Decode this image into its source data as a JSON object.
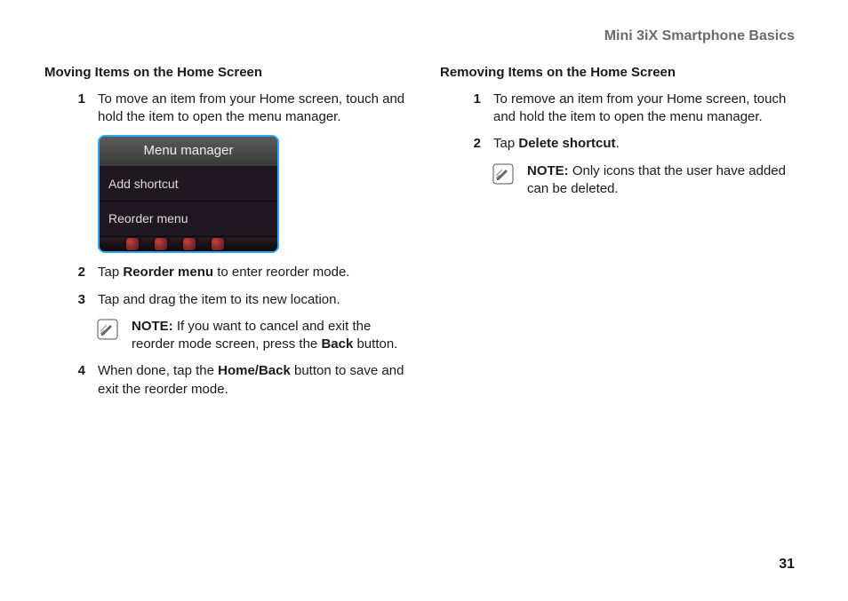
{
  "header": "Mini 3iX Smartphone Basics",
  "page_number": "31",
  "left": {
    "title": "Moving Items on the Home Screen",
    "step1_num": "1",
    "step1_text": "To move an item from your Home screen, touch and hold the item to open the menu manager.",
    "screenshot": {
      "title": "Menu manager",
      "item1": "Add shortcut",
      "item2": "Reorder menu"
    },
    "step2_num": "2",
    "step2_pre": "Tap ",
    "step2_bold": "Reorder menu",
    "step2_post": " to enter reorder mode.",
    "step3_num": "3",
    "step3_text": "Tap and drag the item to its new location.",
    "note_label": "NOTE:",
    "note_pre": " If you want to cancel and exit the reorder mode screen, press the ",
    "note_bold": "Back",
    "note_post": " button.",
    "step4_num": "4",
    "step4_pre": "When done, tap the ",
    "step4_bold": "Home/Back",
    "step4_post": " button to save and exit the reorder mode."
  },
  "right": {
    "title": "Removing Items on the Home Screen",
    "step1_num": "1",
    "step1_text": "To remove an item from your Home screen, touch and hold the item to open the menu manager.",
    "step2_num": "2",
    "step2_pre": "Tap ",
    "step2_bold": "Delete shortcut",
    "step2_post": ".",
    "note_label": "NOTE:",
    "note_text": " Only icons that the user have added can be deleted."
  }
}
